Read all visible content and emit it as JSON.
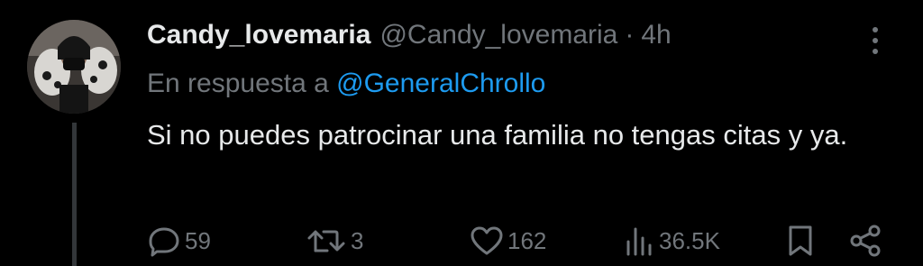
{
  "tweet": {
    "display_name": "Candy_lovemaria",
    "handle": "@Candy_lovemaria",
    "separator": "·",
    "time": "4h",
    "reply_prefix": "En respuesta a",
    "reply_to": "@GeneralChrollo",
    "text": "Si no puedes patrocinar una familia no tengas citas y ya."
  },
  "actions": {
    "replies": "59",
    "retweets": "3",
    "likes": "162",
    "views": "36.5K"
  },
  "icons": {
    "reply": "reply-icon",
    "retweet": "retweet-icon",
    "like": "heart-icon",
    "views": "views-icon",
    "bookmark": "bookmark-icon",
    "share": "share-icon",
    "more": "more-icon"
  },
  "colors": {
    "background": "#000000",
    "text": "#e7e9ea",
    "muted": "#71767b",
    "link": "#1d9bf0",
    "thread_line": "#333639"
  }
}
